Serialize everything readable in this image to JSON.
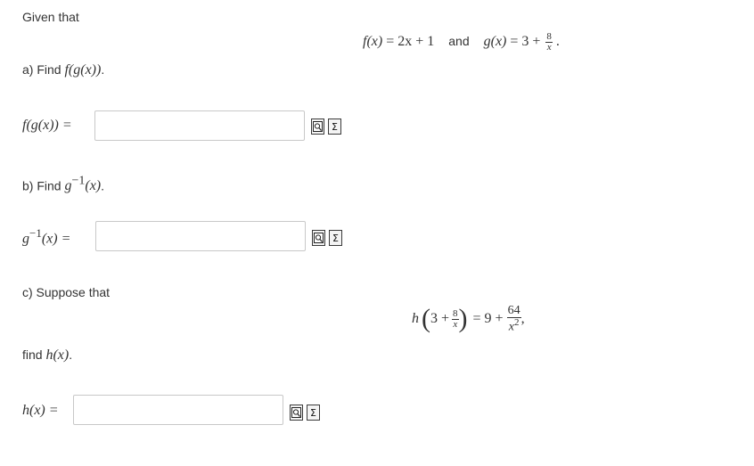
{
  "intro": {
    "given_text": "Given that"
  },
  "given": {
    "f_lhs": "f(x)",
    "f_eq": "= 2x + 1",
    "and": "and",
    "g_lhs": "g(x)",
    "g_eq": "= 3 +",
    "g_num": "8",
    "g_den": "x",
    "tail": "."
  },
  "part_a": {
    "prompt": "a) Find",
    "prompt_math": "f(g(x))",
    "prompt_tail": ".",
    "answer_label": "f(g(x)) =",
    "answer_value": ""
  },
  "part_b": {
    "prompt": "b) Find",
    "prompt_math_base": "g",
    "prompt_math_sup": "−1",
    "prompt_math_arg": "(x)",
    "prompt_tail": ".",
    "answer_label_base": "g",
    "answer_label_sup": "−1",
    "answer_label_rest": "(x) =",
    "answer_value": ""
  },
  "part_c": {
    "suppose": "c) Suppose that",
    "h_name": "h",
    "inner_3": "3 +",
    "inner_num": "8",
    "inner_den": "x",
    "rhs": "= 9 +",
    "rhs_num": "64",
    "rhs_den_base": "x",
    "rhs_den_sup": "2",
    "rhs_tail": ",",
    "find": "find",
    "find_math": "h(x)",
    "find_tail": ".",
    "answer_label": "h(x) =",
    "answer_value": ""
  },
  "tools": {
    "preview_icon": "preview-icon",
    "equation_editor_icon": "sigma-icon",
    "sigma_glyph": "Σ"
  }
}
